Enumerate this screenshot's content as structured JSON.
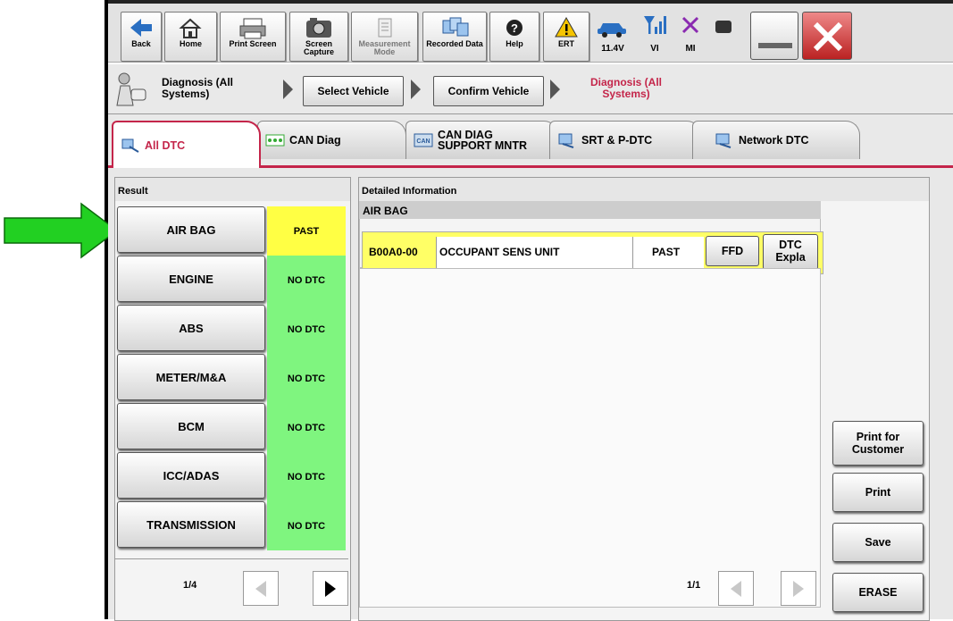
{
  "toolbar": {
    "buttons": [
      {
        "label": "Back",
        "icon": "back-arrow-icon"
      },
      {
        "label": "Home",
        "icon": "home-icon"
      },
      {
        "label": "Print Screen",
        "icon": "printer-icon"
      },
      {
        "label": "Screen Capture",
        "icon": "camera-icon"
      },
      {
        "label": "Measurement Mode",
        "icon": "measurement-icon"
      },
      {
        "label": "Recorded Data",
        "icon": "recorded-data-icon"
      },
      {
        "label": "Help",
        "icon": "help-icon"
      },
      {
        "label": "ERT",
        "icon": "warning-icon"
      }
    ],
    "status": {
      "battery": "11.4V",
      "vi": "VI",
      "mi": "MI"
    }
  },
  "breadcrumb": {
    "current_system": "Diagnosis (All Systems)",
    "step1": "Select Vehicle",
    "step2": "Confirm Vehicle",
    "step3": "Diagnosis (All Systems)"
  },
  "tabs": [
    {
      "label": "All DTC",
      "active": true
    },
    {
      "label": "CAN Diag"
    },
    {
      "label": "CAN DIAG SUPPORT MNTR"
    },
    {
      "label": "SRT & P-DTC"
    },
    {
      "label": "Network DTC"
    }
  ],
  "result": {
    "header": "Result",
    "systems": [
      {
        "name": "AIR BAG",
        "status": "PAST"
      },
      {
        "name": "ENGINE",
        "status": "NO DTC"
      },
      {
        "name": "ABS",
        "status": "NO DTC"
      },
      {
        "name": "METER/M&A",
        "status": "NO DTC"
      },
      {
        "name": "BCM",
        "status": "NO DTC"
      },
      {
        "name": "ICC/ADAS",
        "status": "NO DTC"
      },
      {
        "name": "TRANSMISSION",
        "status": "NO DTC"
      }
    ],
    "page": "1/4"
  },
  "detail": {
    "header": "Detailed Information",
    "system": "AIR BAG",
    "dtc": {
      "code": "B00A0-00",
      "desc": "OCCUPANT SENS UNIT",
      "status": "PAST",
      "ffd": "FFD",
      "expla": "DTC Expla"
    },
    "page": "1/1"
  },
  "side": {
    "print_customer": "Print for Customer",
    "print": "Print",
    "save": "Save",
    "erase": "ERASE"
  },
  "colors": {
    "past": "#ffff44",
    "nodtc": "#7ff57f",
    "accent": "#c4254a",
    "arrow": "#22d022"
  }
}
